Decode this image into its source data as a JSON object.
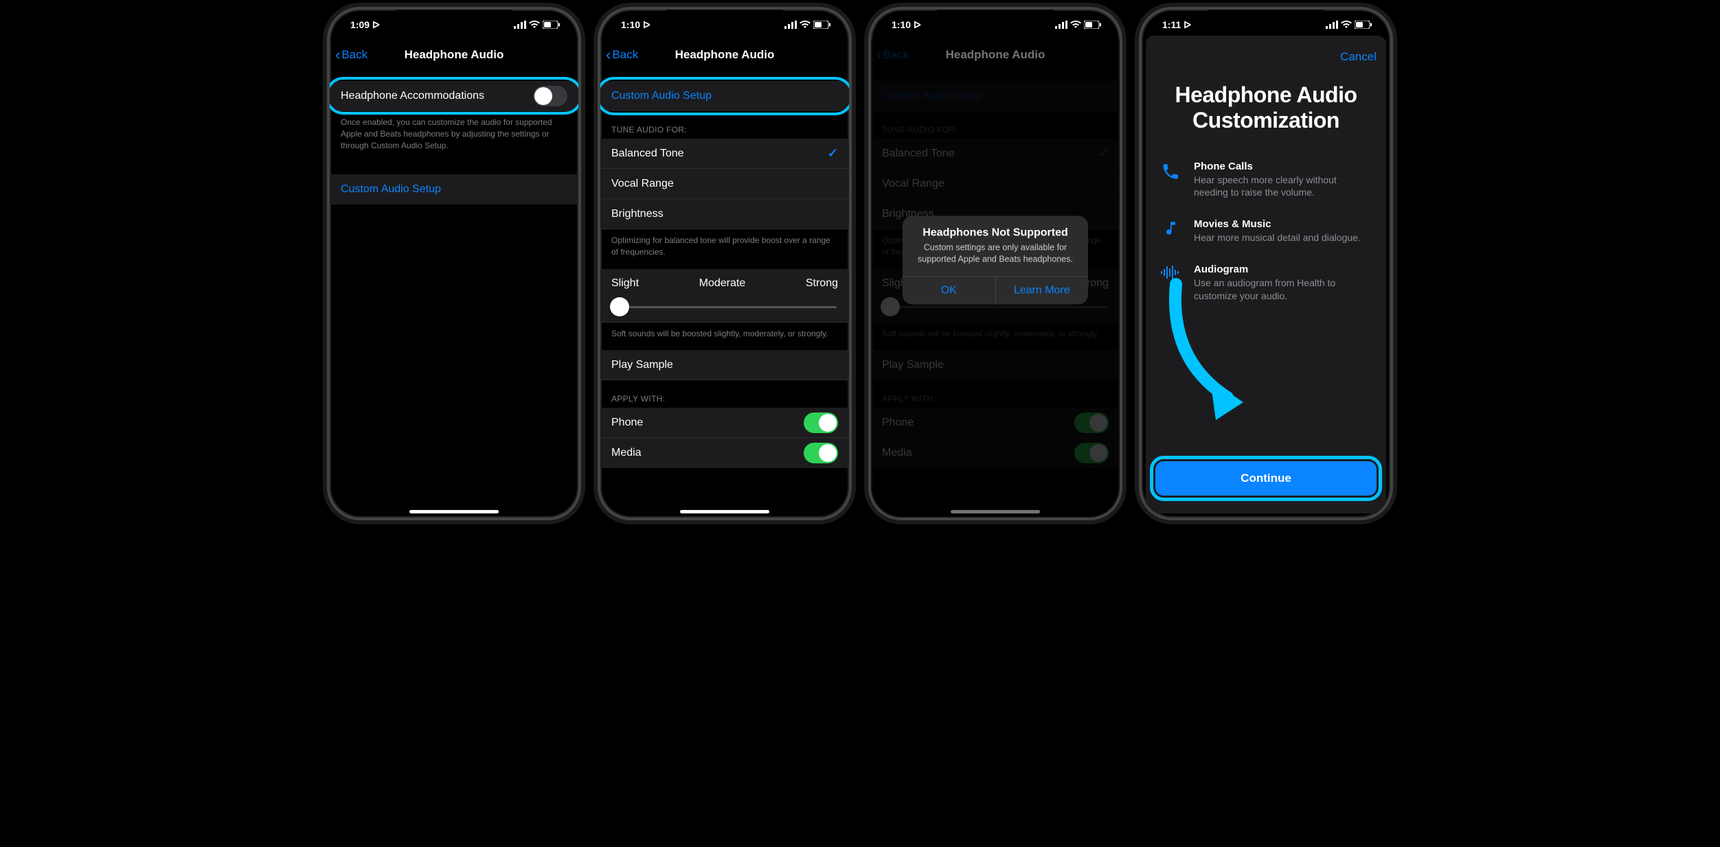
{
  "screens": [
    {
      "time": "1:09",
      "back": "Back",
      "title": "Headphone Audio",
      "rowA": "Headphone Accommodations",
      "footerA": "Once enabled, you can customize the audio for supported Apple and Beats headphones by adjusting the settings or through Custom Audio Setup.",
      "rowB": "Custom Audio Setup"
    },
    {
      "time": "1:10",
      "back": "Back",
      "title": "Headphone Audio",
      "rowA": "Custom Audio Setup",
      "hdrTune": "TUNE AUDIO FOR:",
      "opt1": "Balanced Tone",
      "opt2": "Vocal Range",
      "opt3": "Brightness",
      "footerTune": "Optimizing for balanced tone will provide boost over a range of frequencies.",
      "s1": "Slight",
      "s2": "Moderate",
      "s3": "Strong",
      "footerSlider": "Soft sounds will be boosted slightly, moderately, or strongly.",
      "play": "Play Sample",
      "hdrApply": "APPLY WITH:",
      "apply1": "Phone",
      "apply2": "Media"
    },
    {
      "time": "1:10",
      "back": "Back",
      "title": "Headphone Audio",
      "alertTitle": "Headphones Not Supported",
      "alertMsg": "Custom settings are only available for supported Apple and Beats headphones.",
      "btnOk": "OK",
      "btnLearn": "Learn More"
    },
    {
      "time": "1:11",
      "cancel": "Cancel",
      "sheetTitle": "Headphone Audio Customization",
      "r1t": "Phone Calls",
      "r1s": "Hear speech more clearly without needing to raise the volume.",
      "r2t": "Movies & Music",
      "r2s": "Hear more musical detail and dialogue.",
      "r3t": "Audiogram",
      "r3s": "Use an audiogram from Health to customize your audio.",
      "continue": "Continue"
    }
  ]
}
